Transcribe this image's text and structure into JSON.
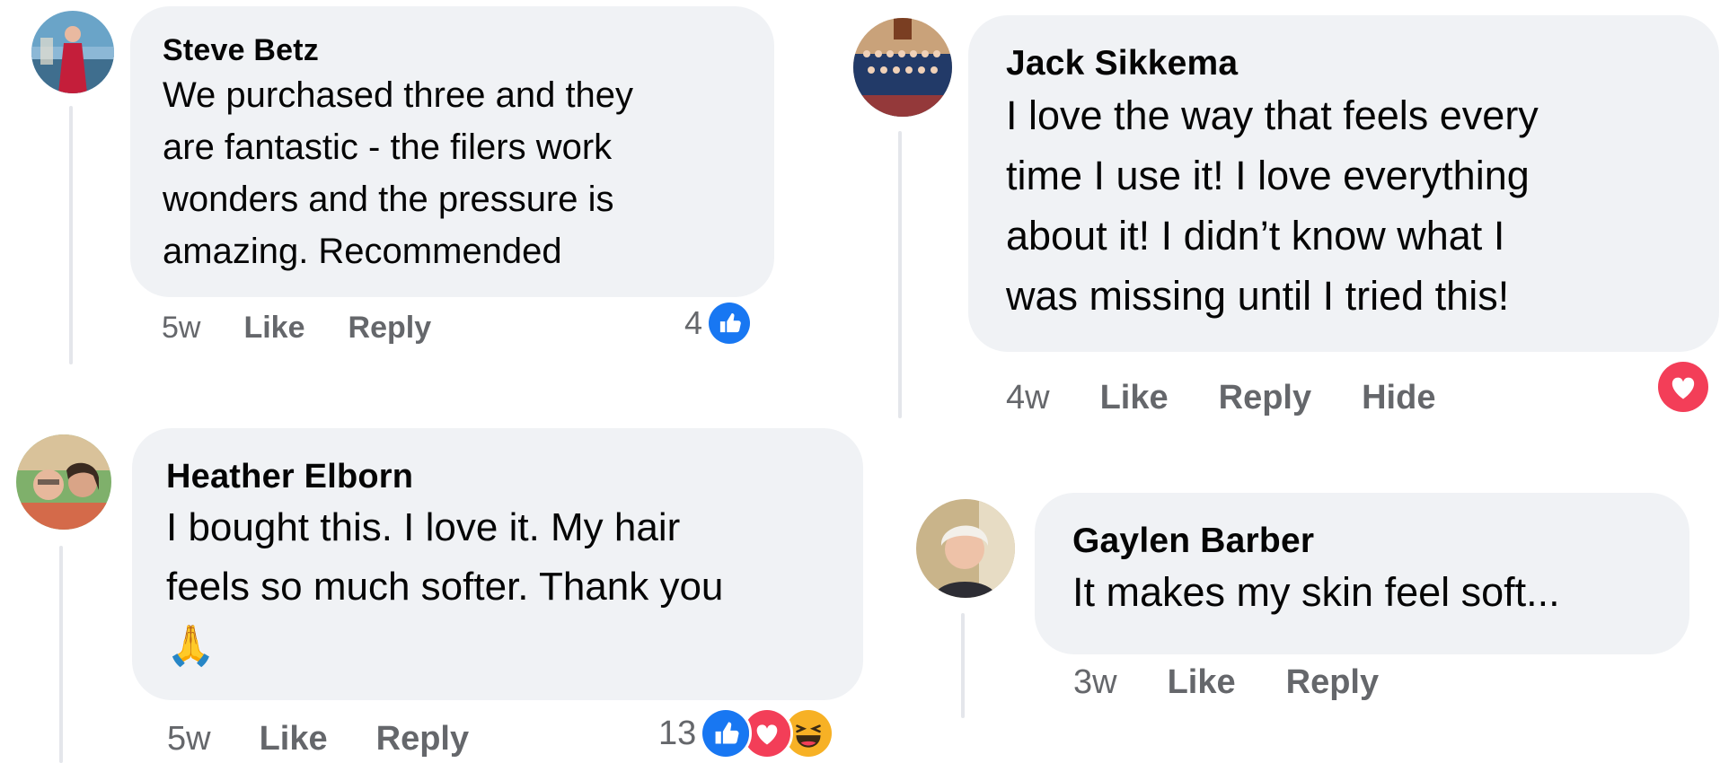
{
  "colors": {
    "bubble": "#f0f2f5",
    "meta_text": "#65676b",
    "like_blue": "#1877f2",
    "love_red": "#f33e58",
    "haha_yellow": "#f7b125"
  },
  "comments": [
    {
      "author": "Steve Betz",
      "text_lines": [
        "We purchased three and they",
        "are fantastic - the filers work",
        "wonders and the pressure is",
        "amazing. Recommended"
      ],
      "time": "5w",
      "actions": [
        "Like",
        "Reply"
      ],
      "reaction_count": "4",
      "reaction_icons": [
        "like-icon"
      ]
    },
    {
      "author": "Jack Sikkema",
      "text_lines": [
        "I love the way that feels every",
        "time I use it! I love everything",
        "about it! I didn’t know what I",
        "was missing until I tried this!"
      ],
      "time": "4w",
      "actions": [
        "Like",
        "Reply",
        "Hide"
      ],
      "reaction_count": "",
      "reaction_icons": [
        "love-icon"
      ]
    },
    {
      "author": "Heather Elborn",
      "text_lines": [
        "I bought this. I love it. My hair",
        "feels so much softer. Thank you"
      ],
      "emoji": "🙏",
      "time": "5w",
      "actions": [
        "Like",
        "Reply"
      ],
      "reaction_count": "13",
      "reaction_icons": [
        "like-icon",
        "love-icon",
        "haha-icon"
      ]
    },
    {
      "author": "Gaylen Barber",
      "text_lines": [
        "It makes my skin feel soft..."
      ],
      "time": "3w",
      "actions": [
        "Like",
        "Reply"
      ],
      "reaction_count": "",
      "reaction_icons": []
    }
  ]
}
